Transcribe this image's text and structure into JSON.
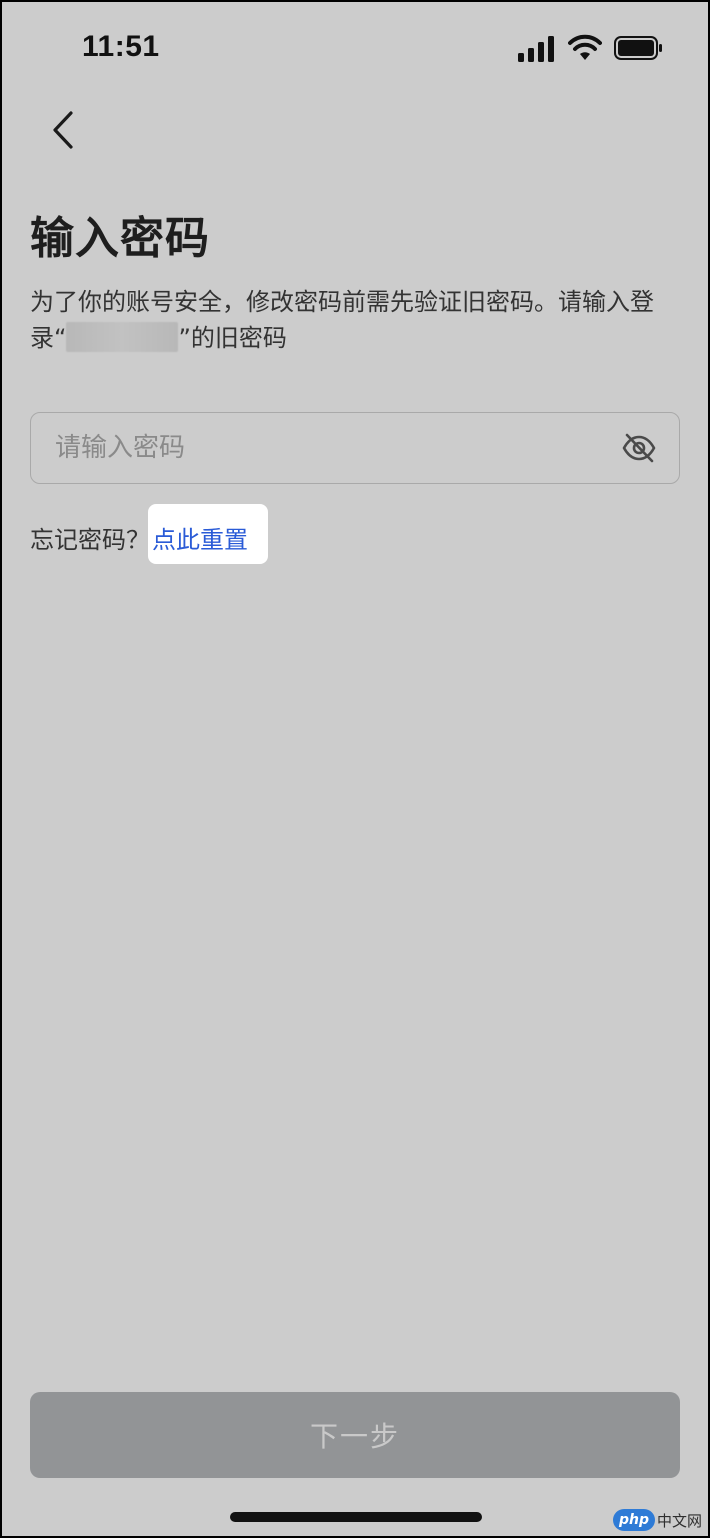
{
  "status_bar": {
    "time": "11:51",
    "signal_icon": "cellular-signal-icon",
    "wifi_icon": "wifi-icon",
    "battery_icon": "battery-icon"
  },
  "nav": {
    "back_icon": "chevron-left-icon"
  },
  "page": {
    "title": "输入密码",
    "description_prefix": "为了你的账号安全，修改密码前需先验证旧密码。请输入登录“",
    "description_suffix": "”的旧密码"
  },
  "password": {
    "placeholder": "请输入密码",
    "value": "",
    "visibility_icon": "eye-off-icon"
  },
  "forgot": {
    "label": "忘记密码？",
    "reset_link": "点此重置"
  },
  "footer": {
    "next_button": "下一步"
  },
  "watermark": {
    "badge": "php",
    "text": "中文网"
  },
  "colors": {
    "background": "#cccccc",
    "link": "#2a5bd7",
    "button_disabled_bg": "#929496",
    "button_disabled_text": "#c9c9c9"
  }
}
